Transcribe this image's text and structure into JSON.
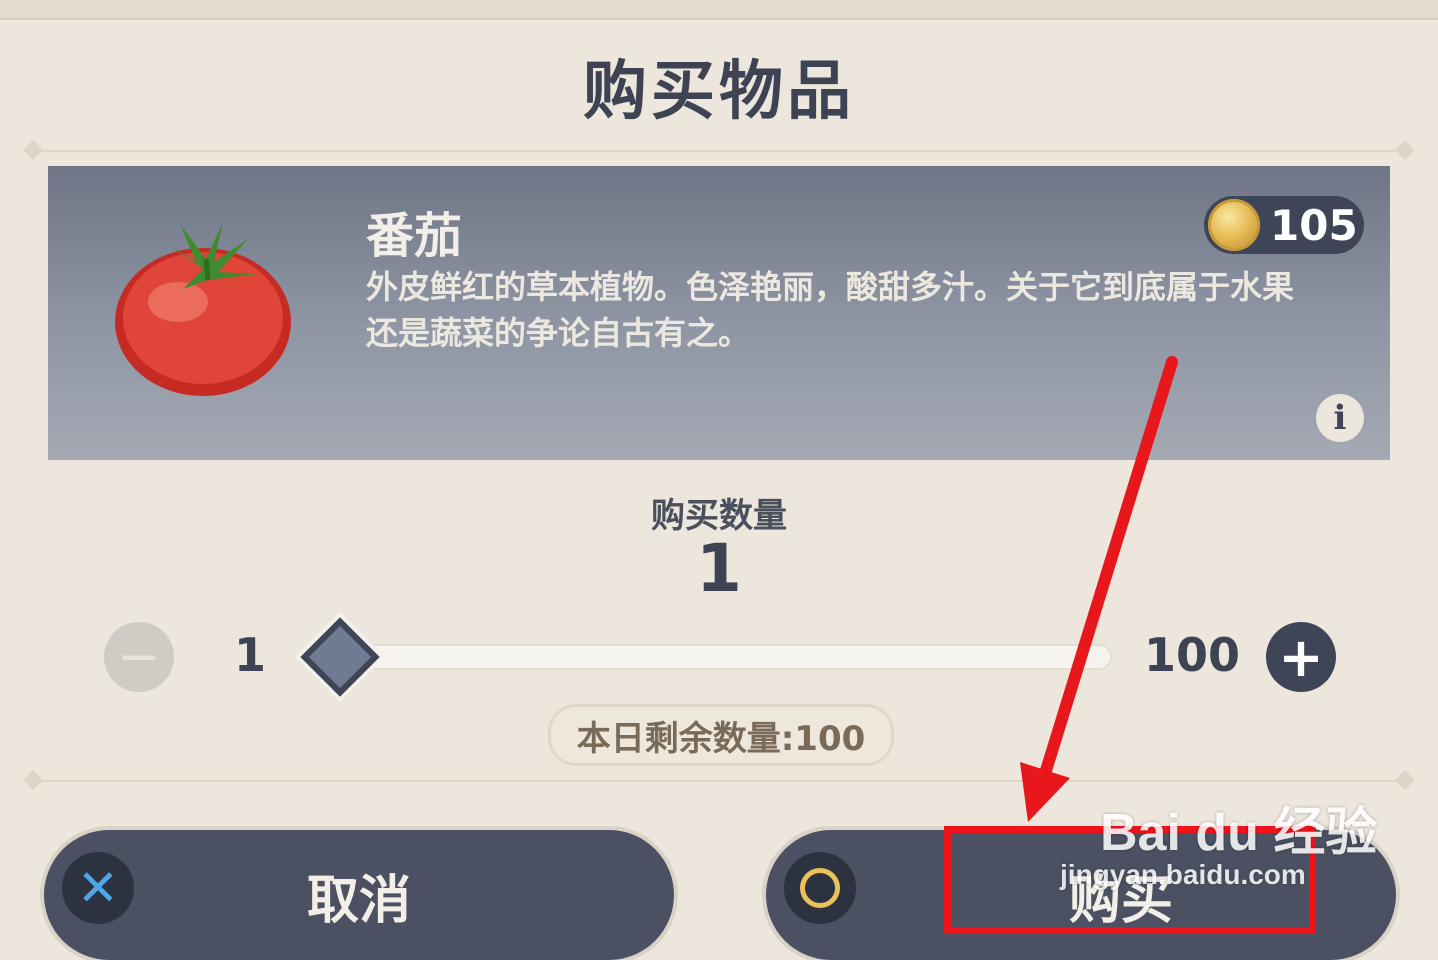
{
  "dialog": {
    "title": "购买物品"
  },
  "item": {
    "name": "番茄",
    "description": "外皮鲜红的草本植物。色泽艳丽，酸甜多汁。关于它到底属于水果还是蔬菜的争论自古有之。",
    "price": "105",
    "price_icon": "mora-coin-icon",
    "image_icon": "tomato-icon",
    "info_glyph": "i"
  },
  "quantity": {
    "label": "购买数量",
    "value": "1",
    "min": "1",
    "max": "100",
    "slider_fraction": 0,
    "minus_glyph": "−",
    "plus_glyph": "+",
    "remaining_label": "本日剩余数量:100"
  },
  "buttons": {
    "cancel_label": "取消",
    "cancel_icon_glyph": "✕",
    "buy_label": "购买"
  },
  "watermark": {
    "logo": "Bai du 经验",
    "site": "jingyan.baidu.com"
  },
  "colors": {
    "background": "#ece6dc",
    "panel_dark": "#3e4556",
    "highlight_red": "#f0141a",
    "coin_gold": "#e5bb55"
  }
}
